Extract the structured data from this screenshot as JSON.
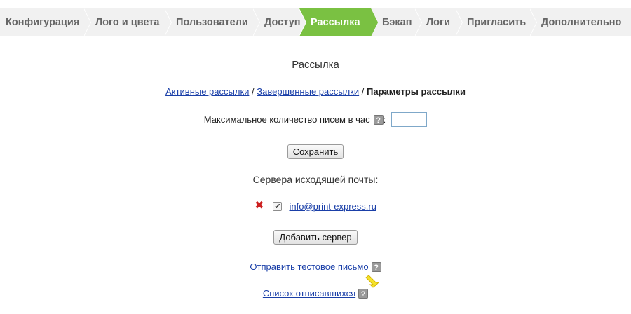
{
  "tabs": [
    {
      "label": "Конфигурация",
      "width": 120
    },
    {
      "label": "Лого и цвета",
      "width": 115
    },
    {
      "label": "Пользователи",
      "width": 126
    },
    {
      "label": "Доступ",
      "width": 66
    },
    {
      "label": "Рассылка",
      "width": 102
    },
    {
      "label": "Бэкап",
      "width": 63
    },
    {
      "label": "Логи",
      "width": 58
    },
    {
      "label": "Пригласить",
      "width": 106
    },
    {
      "label": "Дополнительно",
      "width": 144
    }
  ],
  "active_tab": "Рассылка",
  "colors": {
    "active_tab_bg": "#7ac142",
    "tab_bar_bg": "#f1f1f1",
    "link": "#1a3fa8",
    "delete": "#cc1f1f"
  },
  "page": {
    "title": "Рассылка"
  },
  "breadcrumbs": {
    "active_link": "Активные рассылки",
    "finished_link": "Завершенные рассылки",
    "separator": "/",
    "current": "Параметры рассылки"
  },
  "rate": {
    "label": "Максимальное количество писем в час",
    "colon": ":",
    "value": "",
    "help": "?"
  },
  "buttons": {
    "save": "Сохранить",
    "add_server": "Добавить сервер"
  },
  "servers": {
    "title": "Сервера исходящей почты:",
    "items": [
      {
        "email": "info@print-express.ru",
        "enabled": true
      }
    ]
  },
  "links": {
    "send_test": "Отправить тестовое письмо",
    "unsubscribed": "Список отписавшихся"
  },
  "icons": {
    "help": "help-icon",
    "delete": "delete-icon",
    "checkbox": "checkbox-checked-icon",
    "pointer": "pointer-hand-icon"
  }
}
